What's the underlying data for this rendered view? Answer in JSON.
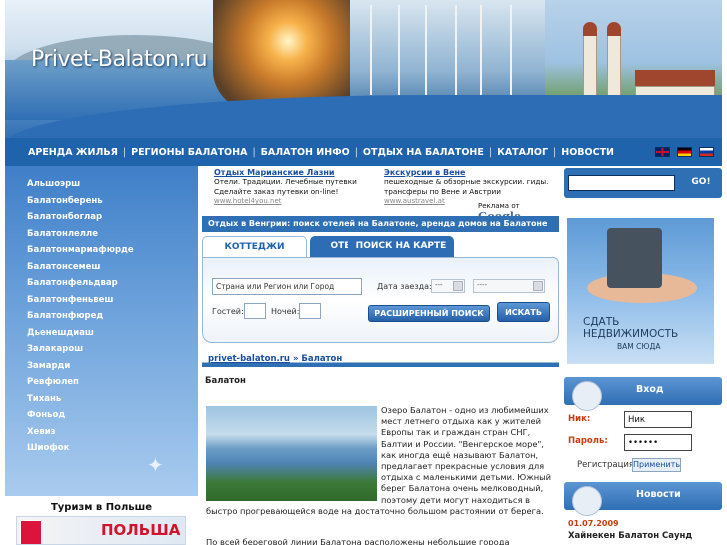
{
  "header": {
    "logo_text": "Privet-Balaton.ru"
  },
  "nav": {
    "items": [
      "АРЕНДА ЖИЛЬЯ",
      "РЕГИОНЫ БАЛАТОНА",
      "БАЛАТОН ИНФО",
      "ОТДЫХ НА БАЛАТОНЕ",
      "КАТАЛОГ",
      "НОВОСТИ"
    ],
    "separator": "|",
    "flags": [
      "english-flag",
      "german-flag",
      "russian-flag"
    ]
  },
  "sidebar": {
    "items": [
      "Альшоэрш",
      "Балатонберень",
      "Балатонбоглар",
      "Балатонлелле",
      "Балатонмариафюрде",
      "Балатонсемеш",
      "Балатонфельдвар",
      "Балатонфеньвеш",
      "Балатонфюред",
      "Дьенешдиаш",
      "Залакарош",
      "Замарди",
      "Ревфюлеп",
      "Тихань",
      "Фоньод",
      "Хевиз",
      "Шиофок"
    ],
    "polska_title": "Туризм в Польше",
    "polska_banner_text": "ПОЛЬША"
  },
  "ads": {
    "ad1": {
      "title": "Отдых Марианские Лазни",
      "text": "Отели. Традиции. Лечебные путевки Сделайте заказ путевки on-line!",
      "url": "www.hotel4you.net"
    },
    "ad2": {
      "title": "Экскурсии в Вене",
      "text": "пешеходные & обзорные экскурсии. гиды. трансферы по Вене и Австрии",
      "url": "www.austravel.at"
    },
    "ads_by": "Реклама от",
    "google": "Google"
  },
  "search": {
    "heading": "Отдых в Венгрии: поиск отелей на Балатоне, аренда домов на Балатоне",
    "tabs": [
      "КОТТЕДЖИ",
      "ОТЕЛИ",
      "ПОИСК НА КАРТЕ"
    ],
    "destination_value": "Страна или Регион или Город",
    "arrival_label": "Дата заезда:",
    "date_day": "---",
    "date_month": "----",
    "guests_label": "Гостей:",
    "nights_label": "Ночей:",
    "advanced_button": "РАСШИРЕННЫЙ ПОИСК",
    "search_button": "ИСКАТЬ"
  },
  "breadcrumb": {
    "link": "privet-balaton.ru",
    "sep": " » ",
    "current": "Балатон"
  },
  "content": {
    "title": "Балатон",
    "paragraph1": "Озеро Балатон - одно из любимейших мест летнего отдыха как у жителей Европы так и граждан стран СНГ, Балтии и России. \"Венгерское море\", как иногда ещё называют Балатон, предлагает прекрасные условия для отдыха с маленькими детьми. Южный берег Балатона очень мелководный, поэтому дети могут находиться в быстро прогревающейся воде на достаточно большом растоянии от берега.",
    "paragraph2": "По всей береговой линии Балатона расположены небольшие города"
  },
  "right": {
    "go_button": "GO!",
    "promo_line1": "СДАТЬ",
    "promo_line2": "НЕДВИЖИМОСТЬ",
    "promo_line3": "ВАМ СЮДА",
    "login_title": "Вход",
    "login_label": "Ник:",
    "login_value": "Ник",
    "password_label": "Пароль:",
    "password_value": "••••••",
    "register_link": "Регистрация",
    "apply_button": "Применить",
    "news_title": "Новости",
    "news_date": "01.07.2009",
    "news_headline": "Хайнекен Балатон Саунд"
  }
}
